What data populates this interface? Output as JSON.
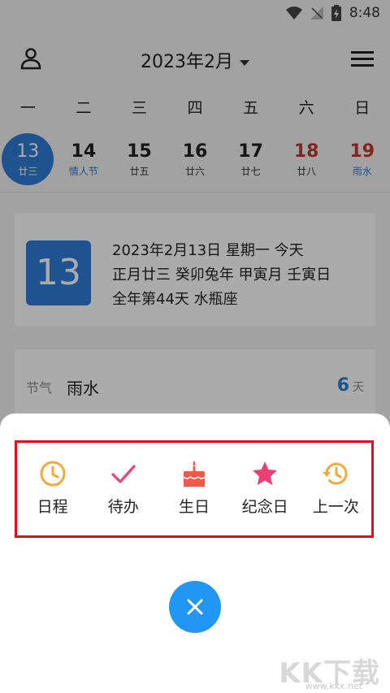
{
  "status_bar": {
    "time": "8:48",
    "icons": [
      "wifi-icon",
      "no-signal-icon",
      "battery-charging-icon"
    ]
  },
  "header": {
    "title": "2023年2月",
    "user_icon": "person-icon",
    "menu_icon": "hamburger-menu-icon"
  },
  "weekdays": [
    "一",
    "二",
    "三",
    "四",
    "五",
    "六",
    "日"
  ],
  "dates": [
    {
      "day": "13",
      "sub": "廿三",
      "today": true
    },
    {
      "day": "14",
      "sub": "情人节",
      "festival": true
    },
    {
      "day": "15",
      "sub": "廿五"
    },
    {
      "day": "16",
      "sub": "廿六"
    },
    {
      "day": "17",
      "sub": "廿七"
    },
    {
      "day": "18",
      "sub": "廿八",
      "weekend": true
    },
    {
      "day": "19",
      "sub": "雨水",
      "weekend": true,
      "festival": true
    }
  ],
  "info_card": {
    "day": "13",
    "line1": "2023年2月13日 星期一 今天",
    "line2": "正月廿三 癸卯兔年 甲寅月 壬寅日",
    "line3": "全年第44天 水瓶座"
  },
  "term_card": {
    "label": "节气",
    "name": "雨水",
    "days": "6",
    "unit": "天"
  },
  "actions": [
    {
      "label": "日程",
      "icon": "clock-icon",
      "color": "#f2a93b"
    },
    {
      "label": "待办",
      "icon": "checkmark-icon",
      "color": "#e8457c"
    },
    {
      "label": "生日",
      "icon": "birthday-cake-icon",
      "color": "#f05a4a"
    },
    {
      "label": "纪念日",
      "icon": "star-icon",
      "color": "#ee3f74"
    },
    {
      "label": "上一次",
      "icon": "history-icon",
      "color": "#f2a93b"
    }
  ],
  "close_button": {
    "icon": "close-icon",
    "color": "#2196f3"
  },
  "watermark": {
    "logo": "KK下载",
    "url": "www.kkx.net"
  }
}
